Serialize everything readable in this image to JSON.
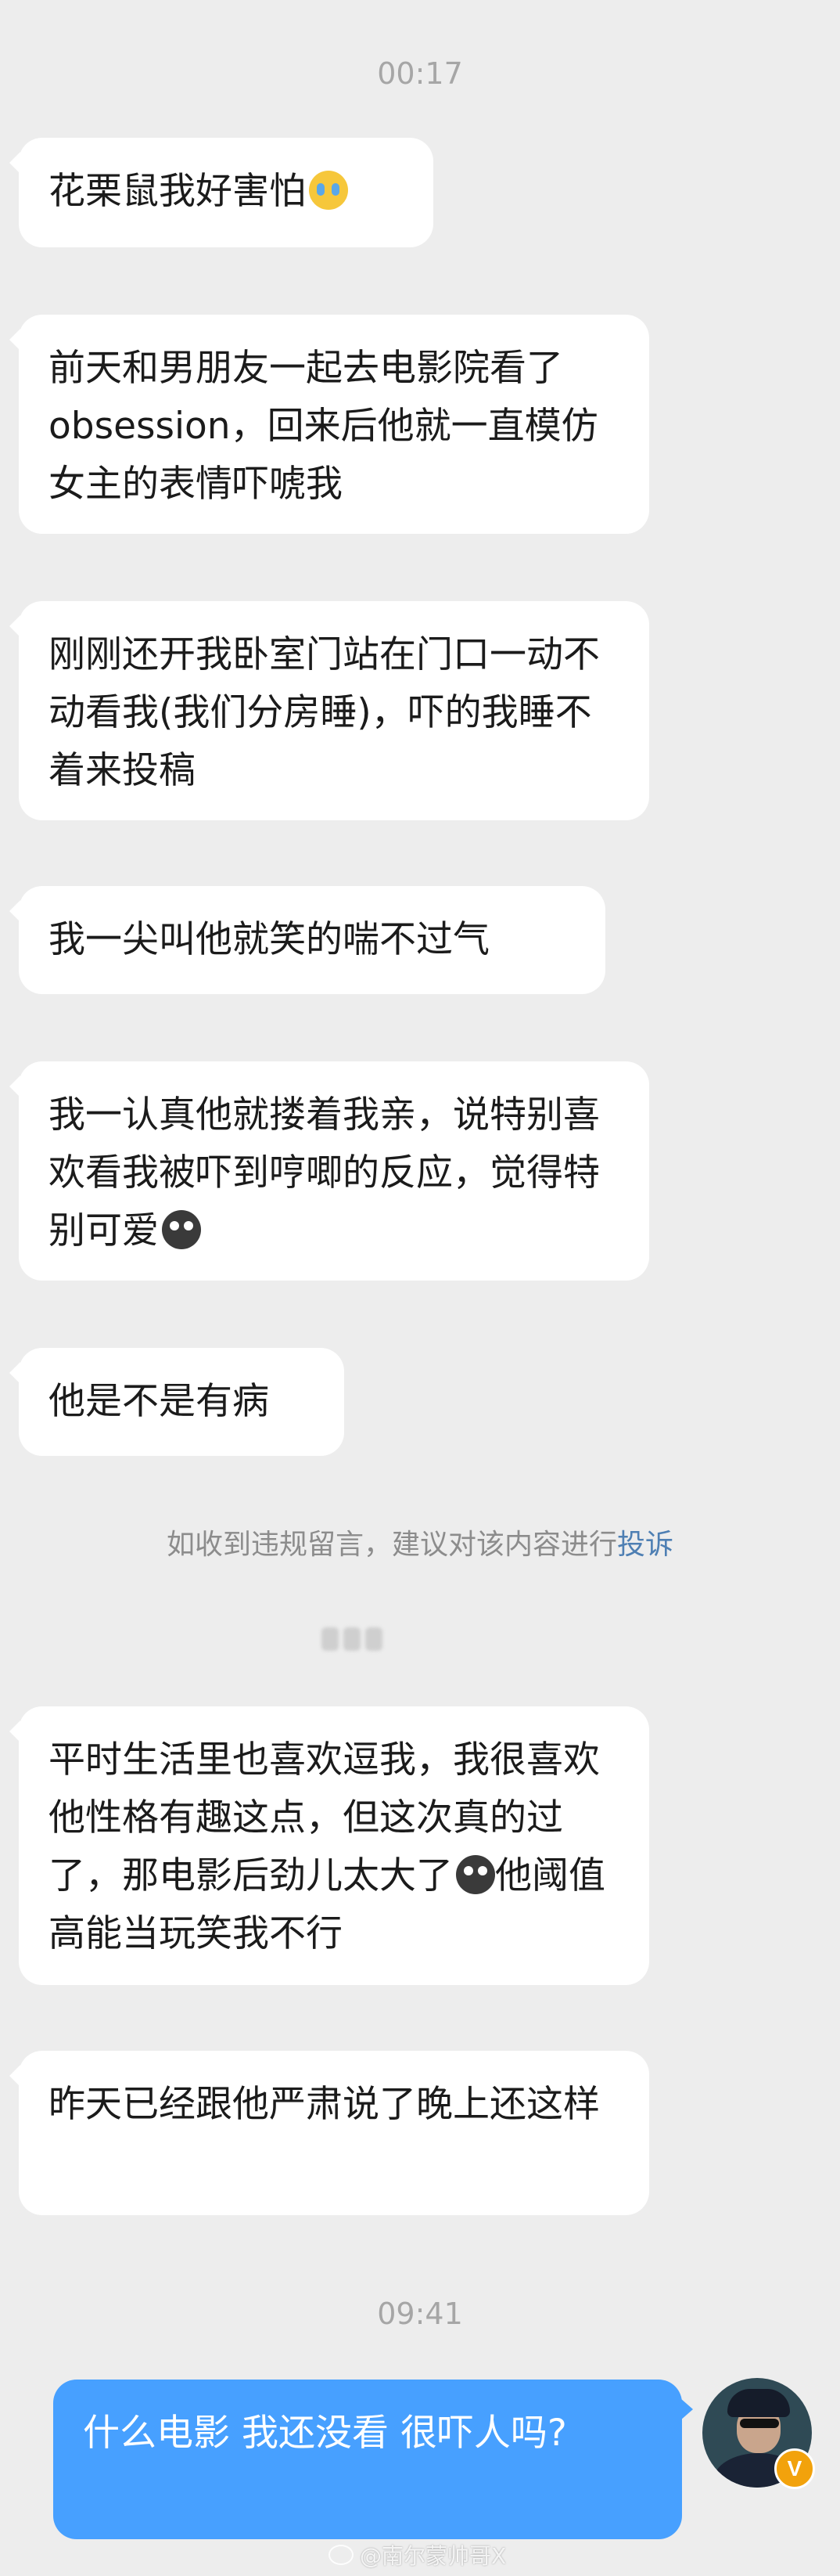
{
  "timestamps": [
    "00:17",
    "09:41"
  ],
  "messages": [
    {
      "text": "花栗鼠我好害怕",
      "emoji": "crying-face"
    },
    {
      "text": "前天和男朋友一起去电影院看了obsession，回来后他就一直模仿女主的表情吓唬我"
    },
    {
      "text": "刚刚还开我卧室门站在门口一动不动看我(我们分房睡)，吓的我睡不着来投稿"
    },
    {
      "text": "我一尖叫他就笑的喘不过气"
    },
    {
      "text_a": "我一认真他就搂着我亲，说特别喜欢看我被吓到哼唧的反应，觉得特别可爱",
      "emoji": "dark-sweat-face"
    },
    {
      "text": "他是不是有病"
    },
    {
      "text_a": "平时生活里也喜欢逗我，我很喜欢他性格有趣这点，但这次真的过了，那电影后劲儿太大了",
      "emoji": "dark-sweat-face",
      "text_b": "他阈值高能当玩笑我不行"
    },
    {
      "text": "昨天已经跟他严肃说了晚上还这样"
    }
  ],
  "system_notice": {
    "text": "如收到违规留言，建议对该内容进行",
    "link": "投诉"
  },
  "reply": {
    "text": "什么电影 我还没看 很吓人吗?"
  },
  "avatar": {
    "badge": "V",
    "icon": "police-officer-avatar"
  },
  "watermark": {
    "text": "@南尔蒙帅哥X",
    "icon": "weibo-icon"
  },
  "colors": {
    "background": "#ededed",
    "incoming_bubble": "#ffffff",
    "outgoing_bubble": "#47a0ff",
    "link": "#4e7fb3",
    "badge": "#f2a20c"
  }
}
